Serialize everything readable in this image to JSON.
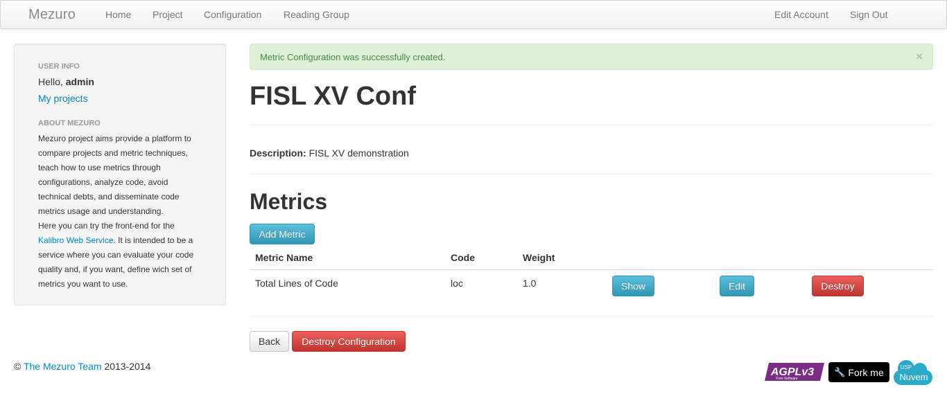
{
  "navbar": {
    "brand": "Mezuro",
    "links": [
      "Home",
      "Project",
      "Configuration",
      "Reading Group"
    ],
    "right_links": [
      "Edit Account",
      "Sign Out"
    ]
  },
  "sidebar": {
    "user_info_header": "USER INFO",
    "hello_prefix": "Hello, ",
    "username": "admin",
    "my_projects": "My projects",
    "about_header": "ABOUT MEZURO",
    "about_text_1": "Mezuro project aims provide a platform to compare projects and metric techniques, teach how to use metrics through configurations, analyze code, avoid technical debts, and disseminate code metrics usage and understanding.",
    "about_text_2_prefix": "Here you can try the front-end for the ",
    "about_link": "Kalibro Web Service",
    "about_text_2_suffix": ". It is intended to be a service where you can evaluate your code quality and, if you want, define wich set of metrics you want to use."
  },
  "alert": {
    "message": "Metric Configuration was successfully created.",
    "close": "×"
  },
  "main": {
    "title": "FISL XV Conf",
    "description_label": "Description:",
    "description_value": "FISL XV demonstration",
    "metrics_heading": "Metrics",
    "add_metric": "Add Metric",
    "table": {
      "headers": [
        "Metric Name",
        "Code",
        "Weight"
      ],
      "rows": [
        {
          "name": "Total Lines of Code",
          "code": "loc",
          "weight": "1.0",
          "show": "Show",
          "edit": "Edit",
          "destroy": "Destroy"
        }
      ]
    },
    "back": "Back",
    "destroy_configuration": "Destroy Configuration"
  },
  "footer": {
    "copyright": "©",
    "team_link": "The Mezuro Team",
    "years": "2013-2014"
  },
  "badges": {
    "agpl": "AGPLv3",
    "agpl_sub": "Free Software",
    "fork": "Fork me",
    "nuvem": "Nuvem",
    "nuvem_top": "USP"
  },
  "colors": {
    "link": "#0088cc",
    "info": "#2f96b4",
    "danger": "#bd362f",
    "success_bg": "#dff0d8",
    "agpl": "#7b2c85",
    "nuvem": "#2aa9c9"
  }
}
